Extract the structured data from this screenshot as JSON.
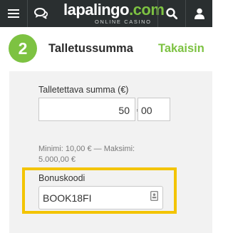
{
  "header": {
    "brand_main": "lapalingo",
    "brand_dot_com": ".com",
    "brand_sub": "ONLINE CASINO",
    "icons": [
      "menu-icon",
      "chat-icon",
      "search-icon",
      "user-icon"
    ]
  },
  "step": {
    "number": "2",
    "title": "Talletussumma",
    "back_label": "Takaisin"
  },
  "deposit": {
    "amount_label": "Talletettava summa (€)",
    "amount_integer": "50",
    "amount_separator": ",",
    "amount_decimal": "00",
    "limits_line1": "Minimi: 10,00 € — Maksimi:",
    "limits_line2": "5.000,00 €"
  },
  "bonus": {
    "label": "Bonuskoodi",
    "code": "BOOK18FI",
    "highlight_color": "#f3c400"
  },
  "colors": {
    "topbar": "#2a2f30",
    "accent_green": "#7dc242",
    "panel": "#f2f2f2"
  }
}
